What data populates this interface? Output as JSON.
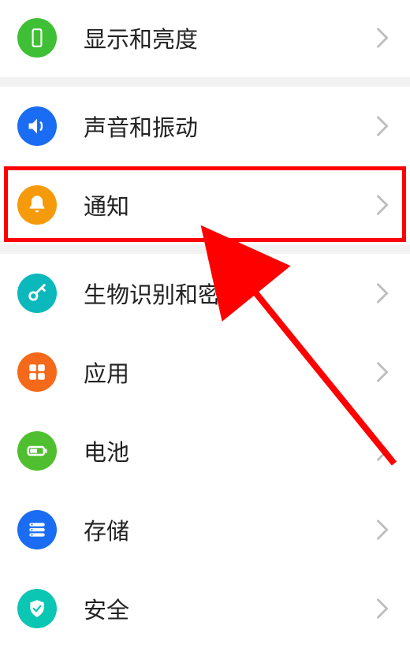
{
  "settings": {
    "items": [
      {
        "label": "显示和亮度",
        "icon": "display-icon",
        "color": "c-green"
      },
      {
        "label": "声音和振动",
        "icon": "sound-icon",
        "color": "c-blue"
      },
      {
        "label": "通知",
        "icon": "bell-icon",
        "color": "c-orange"
      },
      {
        "label": "生物识别和密码",
        "icon": "key-icon",
        "color": "c-teal"
      },
      {
        "label": "应用",
        "icon": "apps-icon",
        "color": "c-orange2"
      },
      {
        "label": "电池",
        "icon": "battery-icon",
        "color": "c-green2"
      },
      {
        "label": "存储",
        "icon": "storage-icon",
        "color": "c-blue2"
      },
      {
        "label": "安全",
        "icon": "security-icon",
        "color": "c-teal2"
      }
    ]
  },
  "annotation": {
    "highlight_index": 2,
    "highlight_color": "#ff0000",
    "arrow_color": "#ff0000"
  }
}
